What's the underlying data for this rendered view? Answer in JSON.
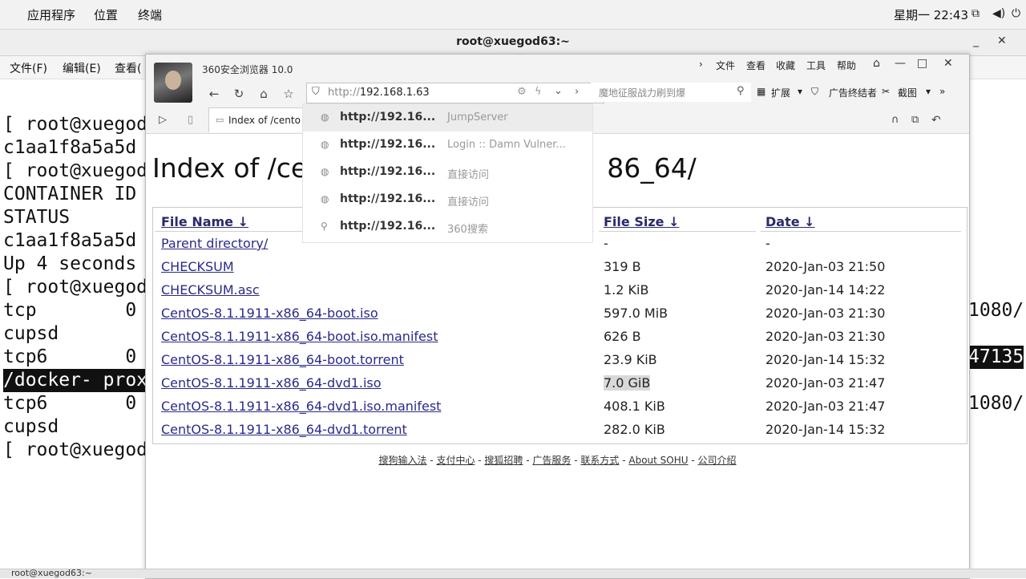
{
  "topbar": {
    "menus": [
      "应用程序",
      "位置",
      "终端"
    ],
    "clock": "星期一 22:43",
    "icons": [
      "network-icon",
      "volume-icon",
      "power-icon"
    ]
  },
  "terminal": {
    "title": "root@xuegod63:~",
    "menu": [
      "文件(F)",
      "编辑(E)",
      "查看("
    ],
    "left_lines": [
      "[ root@xuegod",
      "c1aa1f8a5a5d",
      "[ root@xuegod",
      "CONTAINER ID",
      "STATUS",
      "c1aa1f8a5a5d",
      "Up 4 seconds",
      "[ root@xuegod",
      "tcp        0",
      "cupsd",
      "tcp6       0",
      "/docker- prox",
      "tcp6       0",
      "cupsd",
      "[ root@xuegod"
    ],
    "right_lines": [
      "1080/",
      "47135",
      "1080/"
    ]
  },
  "browser": {
    "app_title": "360安全浏览器 10.0",
    "menus": [
      "文件",
      "查看",
      "收藏",
      "工具",
      "帮助"
    ],
    "url_protocol": "http://",
    "url_host": "192.168.1.63",
    "search_placeholder": "魔地征服战力刷到爆",
    "toolbar": [
      "扩展",
      "广告终结者",
      "截图"
    ],
    "tab_label": "Index of /cento",
    "suggestions": [
      {
        "url": "http://192.16...",
        "desc": "JumpServer",
        "icon": "globe-icon"
      },
      {
        "url": "http://192.16...",
        "desc": "Login :: Damn Vulner...",
        "icon": "globe-icon"
      },
      {
        "url": "http://192.16...",
        "desc": "直接访问",
        "icon": "globe-icon"
      },
      {
        "url": "http://192.16...",
        "desc": "直接访问",
        "icon": "globe-icon"
      },
      {
        "url": "http://192.16...",
        "desc": "360搜索",
        "icon": "search-icon"
      }
    ]
  },
  "page": {
    "title_start": "Index of /ce",
    "title_end": "86_64/",
    "headers": {
      "name": "File Name  ↓",
      "size": "File Size  ↓",
      "date": "Date  ↓"
    },
    "rows": [
      {
        "name": "Parent directory/",
        "size": "-",
        "date": "-"
      },
      {
        "name": "CHECKSUM",
        "size": "319 B",
        "date": "2020-Jan-03 21:50"
      },
      {
        "name": "CHECKSUM.asc",
        "size": "1.2 KiB",
        "date": "2020-Jan-14 14:22"
      },
      {
        "name": "CentOS-8.1.1911-x86_64-boot.iso",
        "size": "597.0 MiB",
        "date": "2020-Jan-03 21:30"
      },
      {
        "name": "CentOS-8.1.1911-x86_64-boot.iso.manifest",
        "size": "626 B",
        "date": "2020-Jan-03 21:30"
      },
      {
        "name": "CentOS-8.1.1911-x86_64-boot.torrent",
        "size": "23.9 KiB",
        "date": "2020-Jan-14 15:32"
      },
      {
        "name": "CentOS-8.1.1911-x86_64-dvd1.iso",
        "size": "7.0 GiB",
        "date": "2020-Jan-03 21:47"
      },
      {
        "name": "CentOS-8.1.1911-x86_64-dvd1.iso.manifest",
        "size": "408.1 KiB",
        "date": "2020-Jan-03 21:47"
      },
      {
        "name": "CentOS-8.1.1911-x86_64-dvd1.torrent",
        "size": "282.0 KiB",
        "date": "2020-Jan-14 15:32"
      }
    ],
    "footer_links": [
      "搜狗输入法",
      "支付中心",
      "搜狐招聘",
      "广告服务",
      "联系方式",
      "About SOHU",
      "公司介绍"
    ],
    "footer_sep": " - "
  },
  "taskbar": {
    "item": "root@xuegod63:~"
  }
}
